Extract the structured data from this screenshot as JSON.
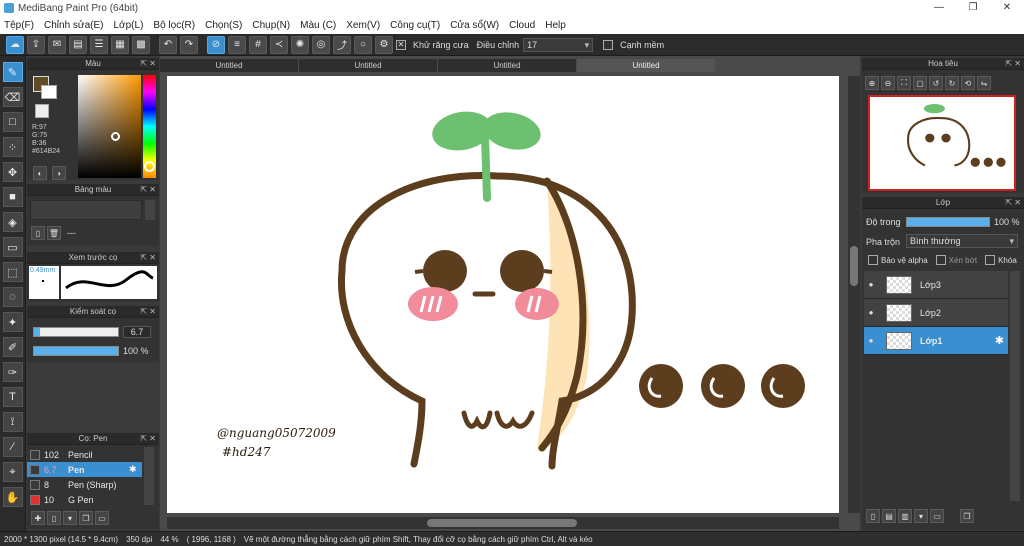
{
  "window": {
    "title": "MediBang Paint Pro (64bit)",
    "minimize": "—",
    "maximize": "❐",
    "close": "✕"
  },
  "menu": [
    "Tệp(F)",
    "Chỉnh sửa(E)",
    "Lớp(L)",
    "Bộ lọc(R)",
    "Chọn(S)",
    "Chụp(N)",
    "Màu (C)",
    "Xem(V)",
    "Công cụ(T)",
    "Cửa sổ(W)",
    "Cloud",
    "Help"
  ],
  "toolbar": {
    "antialias_label": "Khử răng cưa",
    "adjust_label": "Điều chỉnh",
    "adjust_value": "17",
    "smooth_edge_label": "Cạnh mềm"
  },
  "tabs": [
    "Untitled",
    "Untitled",
    "Untitled",
    "Untitled"
  ],
  "color_panel": {
    "title": "Màu",
    "r": "R:97",
    "g": "G:75",
    "b": "B:36",
    "hex": "#614B24",
    "current": "#614B24"
  },
  "palette_panel": {
    "title": "Bảng màu",
    "none_label": "---"
  },
  "brush_preview_panel": {
    "title": "Xem trước cọ",
    "size": "0.49mm"
  },
  "brush_control_panel": {
    "title": "Kiểm soát cọ",
    "size_value": "6.7",
    "opacity_value": "100 %",
    "size_fraction": 0.07,
    "opacity_fraction": 1.0
  },
  "brush_list_panel": {
    "title": "Cọ: Pen",
    "items": [
      {
        "size": "102",
        "name": "Pencil",
        "color": "#3a3a3a"
      },
      {
        "size": "6.7",
        "name": "Pen",
        "color": "#3a3a3a"
      },
      {
        "size": "8",
        "name": "Pen (Sharp)",
        "color": "#3a3a3a"
      },
      {
        "size": "10",
        "name": "G Pen",
        "color": "#e03030"
      }
    ]
  },
  "navigator_panel": {
    "title": "Hoa tiêu"
  },
  "layer_panel": {
    "title": "Lớp",
    "opacity_label": "Độ trong",
    "opacity_value": "100 %",
    "opacity_fraction": 1.0,
    "blend_label": "Pha trộn",
    "blend_value": "Bình thường",
    "protect_alpha_label": "Bảo vệ alpha",
    "clip_label": "Xén bớt",
    "lock_label": "Khóa",
    "layers": [
      {
        "name": "Lớp3"
      },
      {
        "name": "Lớp2"
      },
      {
        "name": "Lớp1"
      }
    ]
  },
  "canvas_text": {
    "signature1": "@nguang05072009",
    "signature2": "#hd247"
  },
  "status": {
    "size": "2000 * 1300 pixel",
    "physical": "(14.5 * 9.4cm)",
    "dpi": "350 dpi",
    "zoom": "44 %",
    "coords": "( 1996, 1168 )",
    "hint": "Vẽ một đường thẳng bằng cách giữ phím Shift, Thay đổi cỡ cọ bằng cách giữ phím Ctrl, Alt và kéo"
  },
  "colors": {
    "accent": "#3a8fd0",
    "brown": "#614B24",
    "green": "#6cc070",
    "cream": "#fde3b5",
    "blush": "#f28b9a"
  }
}
